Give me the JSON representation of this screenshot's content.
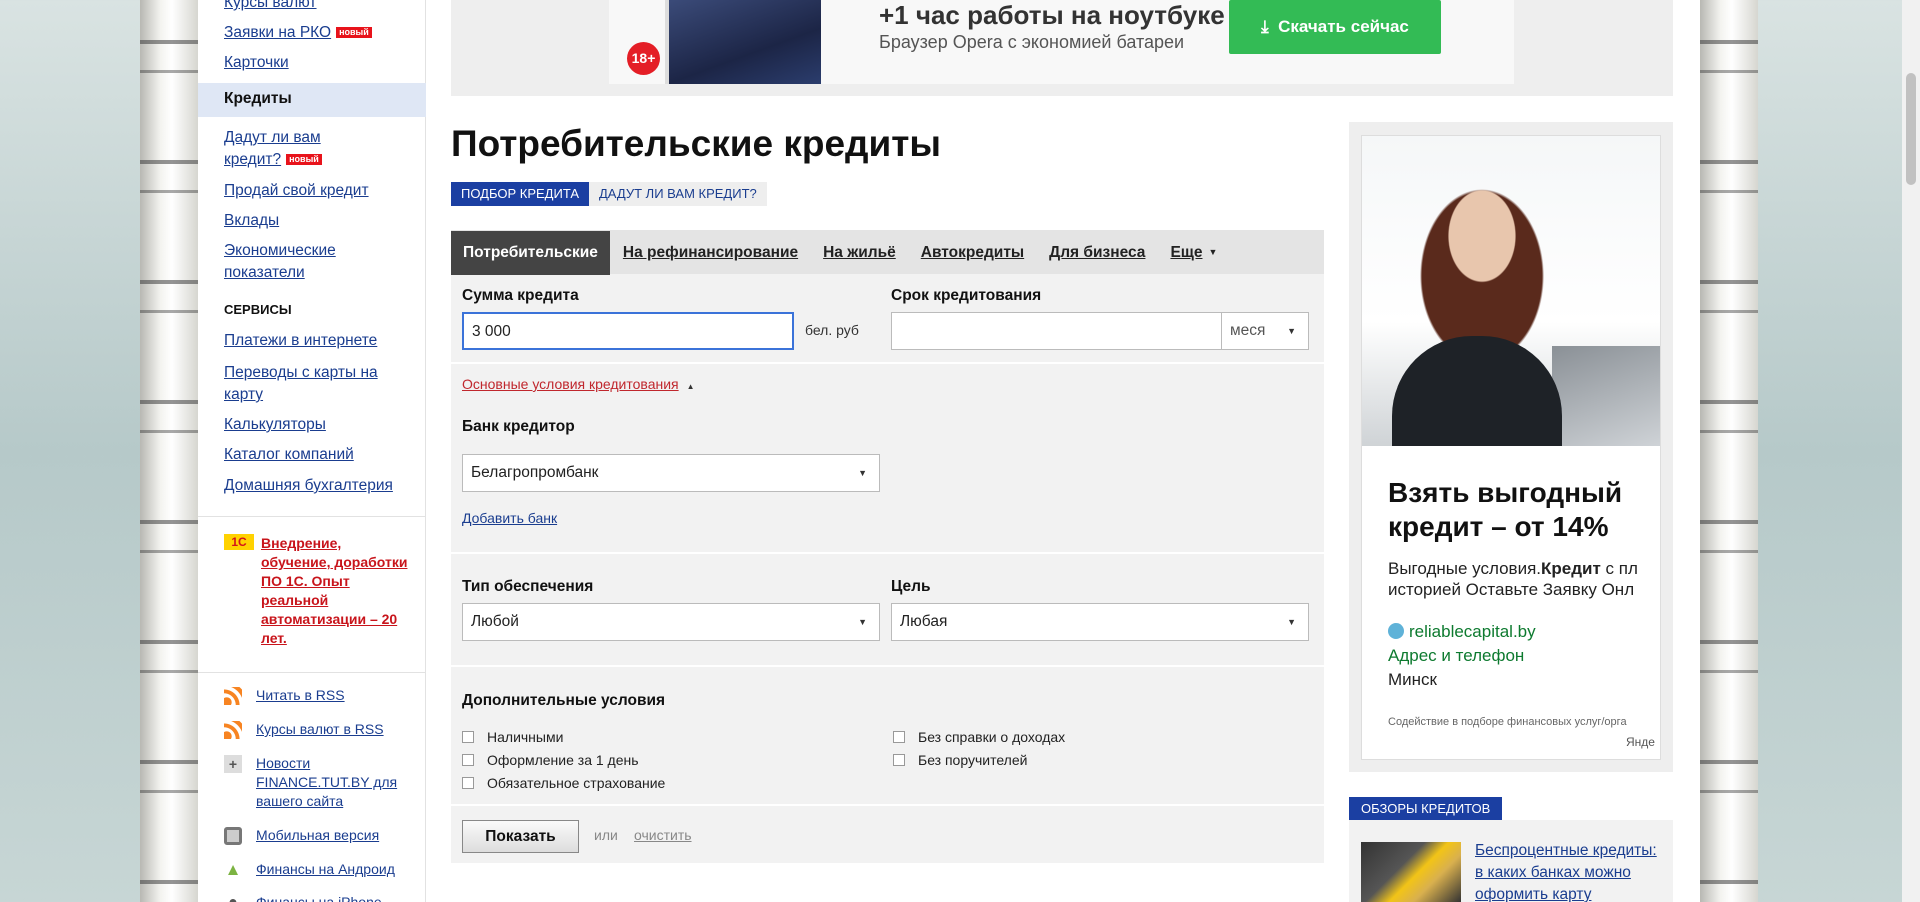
{
  "sidebar": {
    "items": [
      {
        "label": "Курсы валют",
        "badge": ""
      },
      {
        "label": "Заявки на РКО",
        "badge": "новый"
      },
      {
        "label": "Карточки",
        "badge": ""
      }
    ],
    "active": "Кредиты",
    "sub_items": [
      {
        "label": "Дадут ли вам",
        "label2": "кредит?",
        "badge": "новый"
      },
      {
        "label": "Продай свой кредит"
      },
      {
        "label": "Вклады"
      },
      {
        "label": "Экономические",
        "label2": "показатели"
      }
    ],
    "services_head": "СЕРВИСЫ",
    "services": [
      {
        "label": "Платежи в интернете"
      },
      {
        "label": "Переводы с карты на",
        "label2": "карту"
      },
      {
        "label": "Калькуляторы"
      },
      {
        "label": "Каталог компаний"
      },
      {
        "label": "Домашняя бухгалтерия"
      }
    ],
    "promo": {
      "logo": "1С",
      "text": "Внедрение, обучение, доработки ПО 1С. Опыт реальной автоматизации – 20 лет."
    },
    "links": [
      {
        "label": "Читать в RSS",
        "icon": "rss-icon"
      },
      {
        "label": "Курсы валют в RSS",
        "icon": "rss-icon"
      },
      {
        "label": "Новости FINANCE.TUT.BY для вашего сайта",
        "icon": "plus-icon"
      },
      {
        "label": "Мобильная версия",
        "icon": "mobile-icon"
      },
      {
        "label": "Финансы на Андроид",
        "icon": "android-icon"
      },
      {
        "label": "Финансы на iPhone",
        "icon": "apple-icon"
      }
    ]
  },
  "banner": {
    "age": "18+",
    "headline": "+1 час работы на ноутбуке",
    "subline": "Браузер Opera с экономией батареи",
    "button": "Скачать сейчас"
  },
  "main": {
    "title": "Потребительские кредиты",
    "subtabs": [
      "ПОДБОР КРЕДИТА",
      "ДАДУТ ЛИ ВАМ КРЕДИТ?"
    ],
    "tabs": [
      "Потребительские",
      "На рефинансирование",
      "На жильё",
      "Автокредиты",
      "Для бизнеса",
      "Еще"
    ],
    "amount_label": "Сумма кредита",
    "amount_value": "3 000",
    "amount_unit": "бел. руб",
    "term_label": "Срок кредитования",
    "term_value": "",
    "term_unit": "меся",
    "conditions_toggle": "Основные условия кредитования",
    "bank_label": "Банк кредитор",
    "bank_value": "Белагропромбанк",
    "add_bank": "Добавить банк",
    "security_label": "Тип обеспечения",
    "security_value": "Любой",
    "purpose_label": "Цель",
    "purpose_value": "Любая",
    "extra_label": "Дополнительные условия",
    "checkboxes_left": [
      "Наличными",
      "Оформление за 1 день",
      "Обязательное страхование"
    ],
    "checkboxes_right": [
      "Без справки о доходах",
      "Без поручителей"
    ],
    "show_button": "Показать",
    "or": "или",
    "clear": "очистить"
  },
  "ad": {
    "headline": "Взять выгодный кредит – от 14%",
    "desc_1a": "Выгодные условия.",
    "desc_1b": "Кредит",
    "desc_1c": " с пл",
    "desc_2": "историей Оставьте Заявку Онл",
    "domain": "reliablecapital.by",
    "address": "Адрес и телефон",
    "city": "Минск",
    "fine": "Содействие в подборе финансовых услуг/орга",
    "yandex": "Янде"
  },
  "reviews": {
    "head": "ОБЗОРЫ КРЕДИТОВ",
    "item": "Беспроцентные кредиты: в каких банках можно оформить карту"
  },
  "colors": {
    "accent_blue": "#1b3fa2",
    "link_blue": "#1a3d8f",
    "badge_red": "#e8131b",
    "download_green": "#33bb55"
  }
}
